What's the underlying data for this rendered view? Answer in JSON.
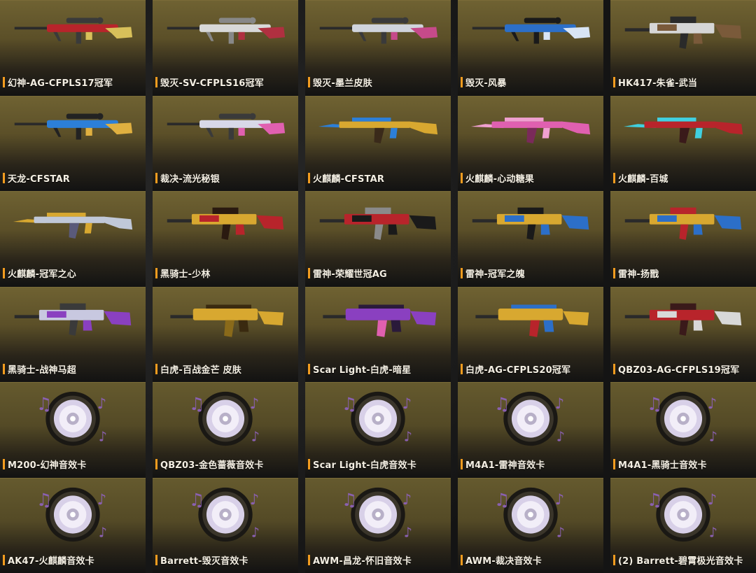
{
  "items": [
    {
      "label": "幻神-AG-CFPLS17冠军",
      "kind": "sniper",
      "colors": [
        "#b8242b",
        "#d8c05a",
        "#3a3a3a"
      ]
    },
    {
      "label": "毁灭-SV-CFPLS16冠军",
      "kind": "sniper",
      "colors": [
        "#d8d8d8",
        "#b03040",
        "#888888"
      ]
    },
    {
      "label": "毁灭-墨兰皮肤",
      "kind": "sniper",
      "colors": [
        "#d0d4dc",
        "#c64a8a",
        "#3a3a3a"
      ]
    },
    {
      "label": "毁灭-风暴",
      "kind": "sniper",
      "colors": [
        "#2c6fc8",
        "#d8e4f4",
        "#1a1a1a"
      ]
    },
    {
      "label": "HK417-朱雀-武当",
      "kind": "rifle",
      "colors": [
        "#d6d6d6",
        "#7a5a3a",
        "#2a2a2a"
      ]
    },
    {
      "label": "天龙-CFSTAR",
      "kind": "sniper",
      "colors": [
        "#2c7fd8",
        "#e0b040",
        "#222222"
      ]
    },
    {
      "label": "裁决-流光秘银",
      "kind": "sniper",
      "colors": [
        "#d8d8e8",
        "#e060b0",
        "#3a3a3a"
      ]
    },
    {
      "label": "火麒麟-CFSTAR",
      "kind": "ak",
      "colors": [
        "#d8a830",
        "#2c7fd8",
        "#3a2a1a"
      ]
    },
    {
      "label": "火麒麟-心动糖果",
      "kind": "ak",
      "colors": [
        "#e060b0",
        "#f0a0d0",
        "#7a2a5a"
      ]
    },
    {
      "label": "火麒麟-百城",
      "kind": "ak",
      "colors": [
        "#b8242b",
        "#40d0e0",
        "#3a1a1a"
      ]
    },
    {
      "label": "火麒麟-冠军之心",
      "kind": "ak",
      "colors": [
        "#c0c8d8",
        "#d8a830",
        "#5a5a7a"
      ]
    },
    {
      "label": "黑骑士-少林",
      "kind": "rifle",
      "colors": [
        "#d8a830",
        "#b8242b",
        "#2a1a10"
      ]
    },
    {
      "label": "雷神-荣耀世冠AG",
      "kind": "rifle",
      "colors": [
        "#b8242b",
        "#1a1a1a",
        "#8a8a8a"
      ]
    },
    {
      "label": "雷神-冠军之魄",
      "kind": "rifle",
      "colors": [
        "#d8a830",
        "#2c6fc8",
        "#1a1a1a"
      ]
    },
    {
      "label": "雷神-扬戬",
      "kind": "rifle",
      "colors": [
        "#d8a830",
        "#2c6fc8",
        "#b8242b"
      ]
    },
    {
      "label": "黑骑士-战神马超",
      "kind": "rifle",
      "colors": [
        "#c8c8e0",
        "#8a40c0",
        "#3a3a3a"
      ]
    },
    {
      "label": "白虎-百战金芒 皮肤",
      "kind": "scar",
      "colors": [
        "#d8a830",
        "#8a6a1a",
        "#3a2a10"
      ]
    },
    {
      "label": "Scar Light-白虎-暗星",
      "kind": "scar",
      "colors": [
        "#8a40c0",
        "#e060b0",
        "#2a1a3a"
      ]
    },
    {
      "label": "白虎-AG-CFPLS20冠军",
      "kind": "scar",
      "colors": [
        "#d8a830",
        "#b8242b",
        "#2c6fc8"
      ]
    },
    {
      "label": "QBZ03-AG-CFPLS19冠军",
      "kind": "rifle",
      "colors": [
        "#b8242b",
        "#d8d8d8",
        "#3a1a1a"
      ]
    },
    {
      "label": "M200-幻神音效卡",
      "kind": "disc",
      "colors": [
        "#d8d0e8",
        "#8a60b0",
        "#1a1a1a"
      ]
    },
    {
      "label": "QBZ03-金色蔷薇音效卡",
      "kind": "disc",
      "colors": [
        "#d8d0e8",
        "#8a60b0",
        "#1a1a1a"
      ]
    },
    {
      "label": "Scar Light-白虎音效卡",
      "kind": "disc",
      "colors": [
        "#d8d0e8",
        "#8a60b0",
        "#1a1a1a"
      ]
    },
    {
      "label": "M4A1-雷神音效卡",
      "kind": "disc",
      "colors": [
        "#d8d0e8",
        "#8a60b0",
        "#1a1a1a"
      ]
    },
    {
      "label": "M4A1-黑骑士音效卡",
      "kind": "disc",
      "colors": [
        "#d8d0e8",
        "#8a60b0",
        "#1a1a1a"
      ]
    },
    {
      "label": "AK47-火麒麟音效卡",
      "kind": "disc",
      "colors": [
        "#d8d0e8",
        "#8a60b0",
        "#1a1a1a"
      ]
    },
    {
      "label": "Barrett-毁灭音效卡",
      "kind": "disc",
      "colors": [
        "#d8d0e8",
        "#8a60b0",
        "#1a1a1a"
      ]
    },
    {
      "label": "AWM-昌龙-怀旧音效卡",
      "kind": "disc",
      "colors": [
        "#d8d0e8",
        "#8a60b0",
        "#1a1a1a"
      ]
    },
    {
      "label": "AWM-裁决音效卡",
      "kind": "disc",
      "colors": [
        "#d8d0e8",
        "#8a60b0",
        "#1a1a1a"
      ]
    },
    {
      "label": "(2) Barrett-碧霄极光音效卡",
      "kind": "disc",
      "colors": [
        "#d8d0e8",
        "#8a60b0",
        "#1a1a1a"
      ]
    }
  ],
  "accent_color": "#f39c1f"
}
